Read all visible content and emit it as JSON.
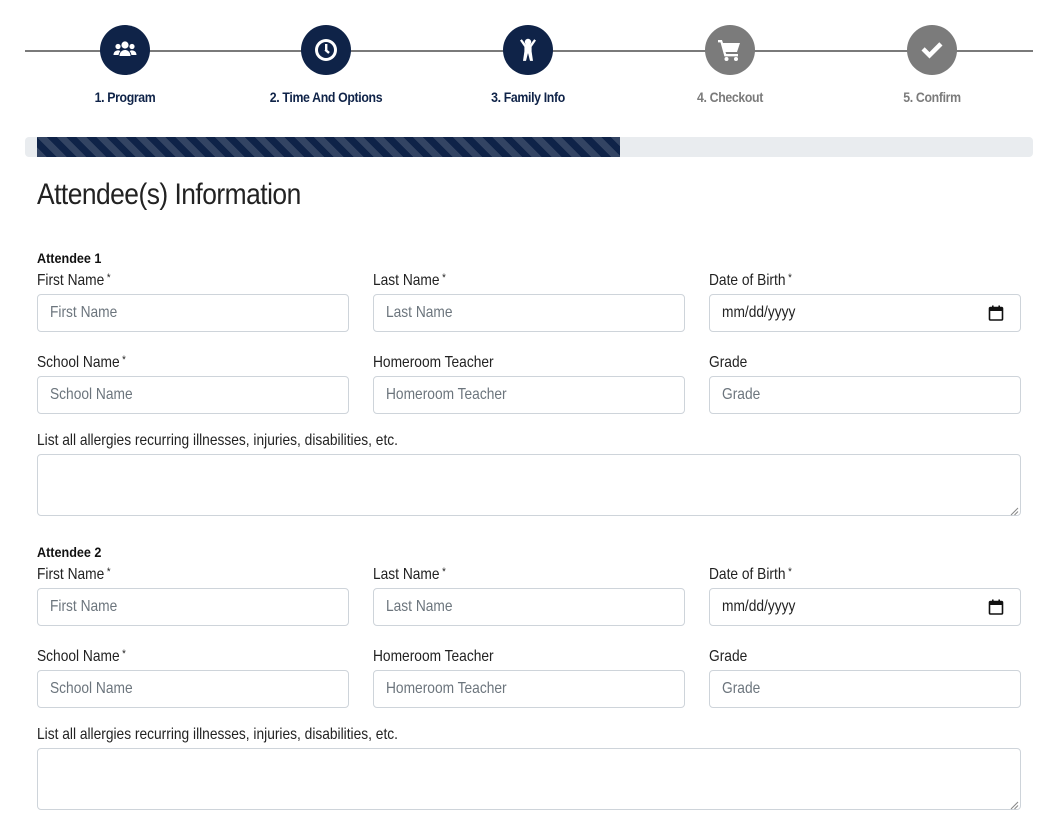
{
  "stepper": {
    "steps": [
      {
        "label": "1. Program",
        "icon": "users-icon",
        "active": true
      },
      {
        "label": "2. Time And Options",
        "icon": "clock-icon",
        "active": true
      },
      {
        "label": "3. Family Info",
        "icon": "child-icon",
        "active": true
      },
      {
        "label": "4. Checkout",
        "icon": "cart-icon",
        "active": false
      },
      {
        "label": "5. Confirm",
        "icon": "check-icon",
        "active": false
      }
    ],
    "progress": 0.585
  },
  "colors": {
    "brand": "#0f2348",
    "inactive": "#7b7b7b",
    "progress_track": "#e9ecef"
  },
  "page_title": "Attendee(s) Information",
  "attendees": [
    {
      "heading": "Attendee 1",
      "first_name": {
        "label": "First Name",
        "required": "*",
        "placeholder": "First Name"
      },
      "last_name": {
        "label": "Last Name",
        "required": "*",
        "placeholder": "Last Name"
      },
      "dob": {
        "label": "Date of Birth",
        "required": "*",
        "value": "mm/dd/yyyy"
      },
      "school": {
        "label": "School Name",
        "required": "*",
        "placeholder": "School Name"
      },
      "teacher": {
        "label": "Homeroom Teacher",
        "placeholder": "Homeroom Teacher"
      },
      "grade": {
        "label": "Grade",
        "placeholder": "Grade"
      },
      "allergies": {
        "label": "List all allergies recurring illnesses, injuries, disabilities, etc.",
        "value": ""
      }
    },
    {
      "heading": "Attendee 2",
      "first_name": {
        "label": "First Name",
        "required": "*",
        "placeholder": "First Name"
      },
      "last_name": {
        "label": "Last Name",
        "required": "*",
        "placeholder": "Last Name"
      },
      "dob": {
        "label": "Date of Birth",
        "required": "*",
        "value": "mm/dd/yyyy"
      },
      "school": {
        "label": "School Name",
        "required": "*",
        "placeholder": "School Name"
      },
      "teacher": {
        "label": "Homeroom Teacher",
        "placeholder": "Homeroom Teacher"
      },
      "grade": {
        "label": "Grade",
        "placeholder": "Grade"
      },
      "allergies": {
        "label": "List all allergies recurring illnesses, injuries, disabilities, etc.",
        "value": ""
      }
    }
  ]
}
